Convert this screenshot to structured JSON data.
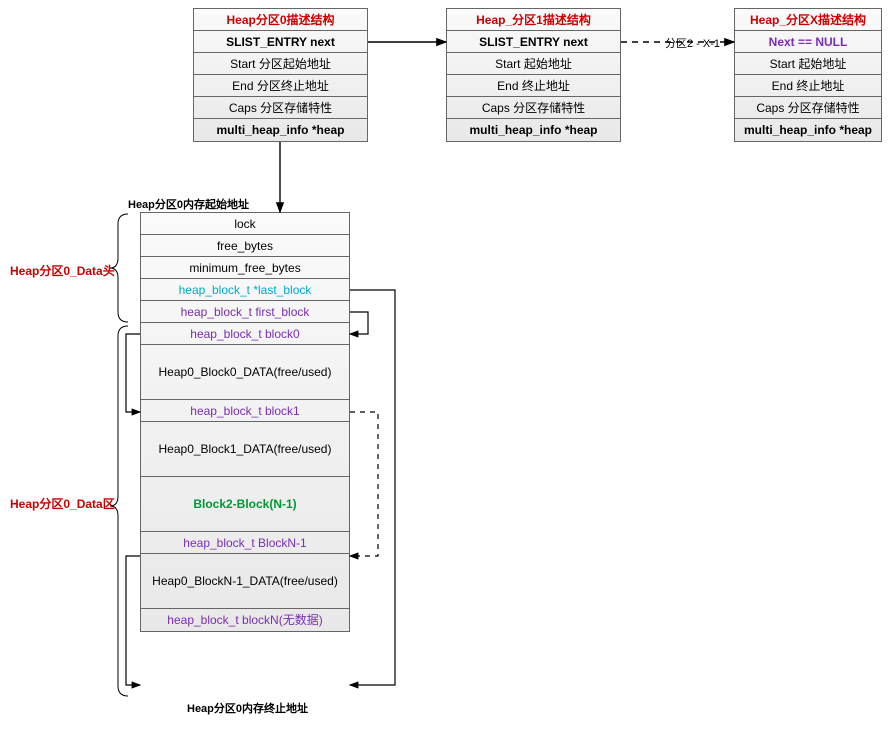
{
  "top": {
    "heap0": {
      "title": "Heap分区0描述结构",
      "rows": [
        "SLIST_ENTRY next",
        "Start  分区起始地址",
        "End   分区终止地址",
        "Caps 分区存储特性",
        "multi_heap_info *heap"
      ]
    },
    "heap1": {
      "title": "Heap_分区1描述结构",
      "rows": [
        "SLIST_ENTRY next",
        "Start 起始地址",
        "End 终止地址",
        "Caps 分区存储特性",
        "multi_heap_info *heap"
      ]
    },
    "gap_label": "分区2 - X-1",
    "heapX": {
      "title": "Heap_分区X描述结构",
      "rows": [
        "Next == NULL",
        "Start 起始地址",
        "End 终止地址",
        "Caps 分区存储特性",
        "multi_heap_info *heap"
      ]
    }
  },
  "labels": {
    "mem_start": "Heap分区0内存起始地址",
    "data_head": "Heap分区0_Data头",
    "data_area": "Heap分区0_Data区",
    "mem_end": "Heap分区0内存终止地址"
  },
  "mem": {
    "r0": "lock",
    "r1": "free_bytes",
    "r2": "minimum_free_bytes",
    "r3": "heap_block_t *last_block",
    "r4": "heap_block_t  first_block",
    "r5": "heap_block_t  block0",
    "r6": "Heap0_Block0_DATA(free/used)",
    "r7": "heap_block_t  block1",
    "r8": "Heap0_Block1_DATA(free/used)",
    "r9": "Block2-Block(N-1)",
    "r10": "heap_block_t BlockN-1",
    "r11": "Heap0_BlockN-1_DATA(free/used)",
    "r12": "heap_block_t  blockN(无数据)"
  }
}
